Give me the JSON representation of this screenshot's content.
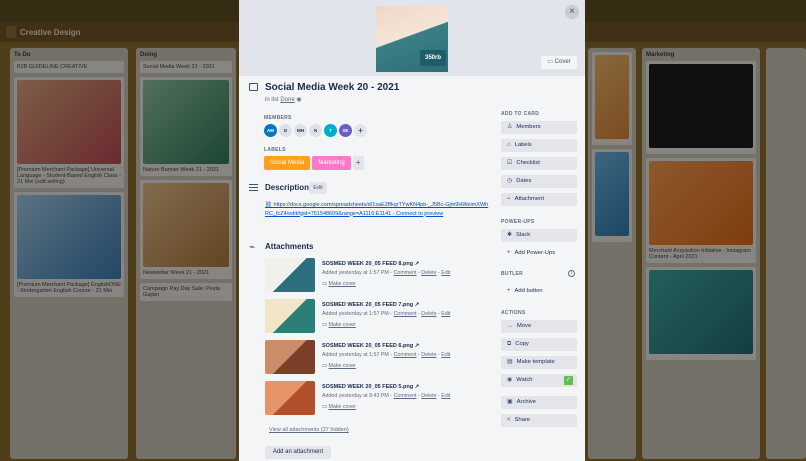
{
  "board": {
    "title": "Creative Design",
    "lists": [
      {
        "name": "To Do",
        "cards": [
          "B2B GUIDELINE CREATIVE",
          "[Premium Merchant Package] Universal Language - Student-Based English Class - 21 Mei (soft selling)",
          "[Premium Merchant Package] EnglishONE - Kindergarten English Course - 21 Mei"
        ]
      },
      {
        "name": "Doing",
        "cards": [
          "Social Media Week 21 - 2021",
          "Nature Banner Week 21 - 2021",
          "Newsletter Week 21 - 2021",
          "Campaign Pay Day Sale: Pesta Gajian"
        ]
      },
      {
        "name": "Marketing",
        "cards": [
          "Merchant Acquisition Initiative - Instagram Content - April 2021"
        ]
      }
    ]
  },
  "modal": {
    "cover_badge": "350rb",
    "cover_button": "Cover",
    "close": "×",
    "title": "Social Media Week 20 - 2021",
    "in_list_prefix": "in list",
    "in_list_name": "Done",
    "members_label": "MEMBERS",
    "members": [
      {
        "initials": "AM",
        "color": "#0079bf"
      },
      {
        "initials": "G",
        "color": "#dfe1e6"
      },
      {
        "initials": "MH",
        "color": "#dfe1e6"
      },
      {
        "initials": "N",
        "color": "#dfe1e6"
      },
      {
        "initials": "T",
        "color": "#00aecc"
      },
      {
        "initials": "SE",
        "color": "#6b5fc7"
      }
    ],
    "labels_label": "LABELS",
    "labels": [
      {
        "text": "Social Media",
        "color": "#ff9f1a"
      },
      {
        "text": "Marketing",
        "color": "#ff78cb"
      }
    ],
    "description_title": "Description",
    "description_edit": "Edit",
    "description_link": "https://docs.google.com/spreadsheets/d/1saE2ffkqrTYwKN4pb-_J5Bc-Gjm9HWeimXWhRC_fcZ4/edit#gid=751548609&range=A1116:E1141 - Connect to preview",
    "attachments_title": "Attachments",
    "attachments": [
      {
        "name": "SOSMED WEEK 20_05 FEED 8.png",
        "meta_prefix": "Added yesterday at 1:57 PM -",
        "comment": "Comment",
        "delete": "Delete",
        "edit": "Edit",
        "cover": "Make cover"
      },
      {
        "name": "SOSMED WEEK 20_05 FEED 7.png",
        "meta_prefix": "Added yesterday at 1:57 PM -",
        "comment": "Comment",
        "delete": "Delete",
        "edit": "Edit",
        "cover": "Make cover"
      },
      {
        "name": "SOSMED WEEK 20_05 FEED 6.png",
        "meta_prefix": "Added yesterday at 1:57 PM -",
        "comment": "Comment",
        "delete": "Delete",
        "edit": "Edit",
        "cover": "Make cover"
      },
      {
        "name": "SOSMED WEEK 20_05 FEED 5.png",
        "meta_prefix": "Added yesterday at 8:43 PM -",
        "comment": "Comment",
        "delete": "Delete",
        "edit": "Edit",
        "cover": "Make cover"
      }
    ],
    "view_all": "View all attachments (27 hidden)",
    "add_attachment": "Add an attachment",
    "sidebar": {
      "add_to_card": "ADD TO CARD",
      "members": "Members",
      "labels": "Labels",
      "checklist": "Checklist",
      "dates": "Dates",
      "attachment": "Attachment",
      "power_ups": "POWER-UPS",
      "slack": "Slack",
      "add_power_ups": "Add Power-Ups",
      "butler": "BUTLER",
      "add_button": "Add button",
      "actions": "ACTIONS",
      "move": "Move",
      "copy": "Copy",
      "make_template": "Make template",
      "watch": "Watch",
      "archive": "Archive",
      "share": "Share"
    }
  }
}
